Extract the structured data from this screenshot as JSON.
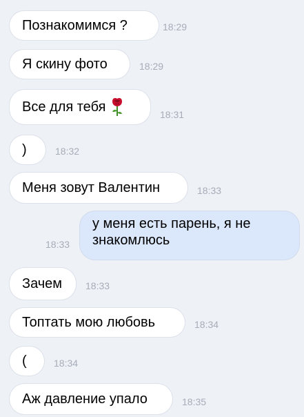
{
  "messages": [
    {
      "text": "Познакомимся ?",
      "time": "18:29",
      "direction": "incoming"
    },
    {
      "text": "Я скину фото",
      "time": "18:29",
      "direction": "incoming"
    },
    {
      "text": "Все для тебя",
      "time": "18:31",
      "direction": "incoming",
      "emoji": "rose-icon"
    },
    {
      "text": ")",
      "time": "18:32",
      "direction": "incoming"
    },
    {
      "text": "Меня зовут Валентин",
      "time": "18:33",
      "direction": "incoming"
    },
    {
      "text": "у меня есть парень, я не знакомлюсь",
      "time": "18:33",
      "direction": "outgoing"
    },
    {
      "text": "Зачем",
      "time": "18:33",
      "direction": "incoming"
    },
    {
      "text": "Топтать мою любовь",
      "time": "18:34",
      "direction": "incoming"
    },
    {
      "text": "(",
      "time": "18:34",
      "direction": "incoming"
    },
    {
      "text": "Аж давление упало",
      "time": "18:35",
      "direction": "incoming"
    }
  ],
  "colors": {
    "background": "#eef1f6",
    "incoming_bubble": "#ffffff",
    "outgoing_bubble": "#dbe7fb",
    "timestamp": "#a6acb8"
  }
}
